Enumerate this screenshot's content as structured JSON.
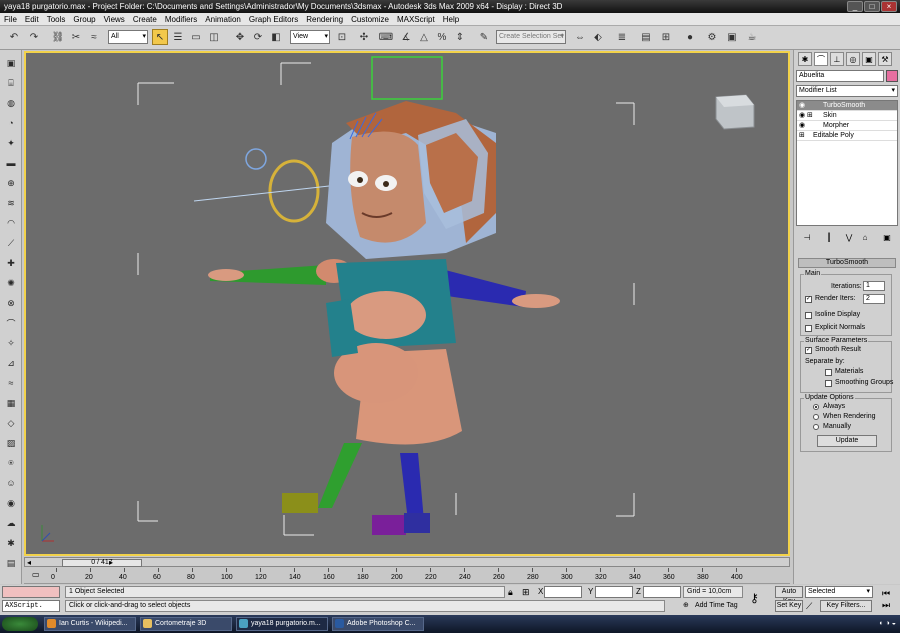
{
  "window": {
    "title": "yaya18 purgatorio.max    - Project Folder: C:\\Documents and Settings\\Administrador\\My Documents\\3dsmax      - Autodesk 3ds Max  2009 x64      - Display : Direct 3D"
  },
  "menu": [
    "File",
    "Edit",
    "Tools",
    "Group",
    "Views",
    "Create",
    "Modifiers",
    "Animation",
    "Graph Editors",
    "Rendering",
    "Customize",
    "MAXScript",
    "Help"
  ],
  "toolbar": {
    "filter": "All",
    "ref_coord": "View",
    "named_selection": "Create Selection Set"
  },
  "command_panel": {
    "object_name": "Abuelita",
    "object_color": "#e66fa0",
    "modifier_list": "Modifier List",
    "stack": [
      {
        "label": "TurboSmooth",
        "selected": true
      },
      {
        "label": "Skin",
        "selected": false
      },
      {
        "label": "Morpher",
        "selected": false
      },
      {
        "label": "Editable Poly",
        "selected": false
      }
    ],
    "rollout": {
      "title": "TurboSmooth",
      "main": {
        "title": "Main",
        "iterations_label": "Iterations:",
        "iterations": "1",
        "render_iters_label": "Render Iters:",
        "render_iters": "2",
        "isoline": "Isoline Display",
        "explicit_normals": "Explicit Normals"
      },
      "surface": {
        "title": "Surface Parameters",
        "smooth_result": "Smooth Result",
        "separate_by": "Separate by:",
        "materials": "Materials",
        "smoothing_groups": "Smoothing Groups"
      },
      "update": {
        "title": "Update Options",
        "always": "Always",
        "when_rendering": "When Rendering",
        "manually": "Manually",
        "update_button": "Update"
      }
    }
  },
  "timeline": {
    "slider": "0 / 417",
    "ticks": [
      "0",
      "20",
      "40",
      "60",
      "80",
      "100",
      "120",
      "140",
      "160",
      "180",
      "200",
      "220",
      "240",
      "260",
      "280",
      "300",
      "320",
      "340",
      "360",
      "380",
      "400"
    ]
  },
  "status": {
    "maxscript": "AXScript.",
    "selection": "1 Object Selected",
    "prompt": "Click or click-and-drag to select objects",
    "x_label": "X",
    "y_label": "Y",
    "z_label": "Z",
    "grid": "Grid = 10,0cm",
    "add_time_tag": "Add Time Tag",
    "auto_key": "Auto Key",
    "set_key": "Set Key",
    "selected": "Selected",
    "key_filters": "Key Filters..."
  },
  "taskbar": {
    "tasks": [
      {
        "label": "Ian Curtis - Wikipedi...",
        "color": "#e08a2a"
      },
      {
        "label": "Cortometraje 3D",
        "color": "#e8c060"
      },
      {
        "label": "yaya18 purgatorio.m...",
        "color": "#4aa0c0"
      },
      {
        "label": "Adobe Photoshop C...",
        "color": "#2a5aa0"
      }
    ]
  }
}
